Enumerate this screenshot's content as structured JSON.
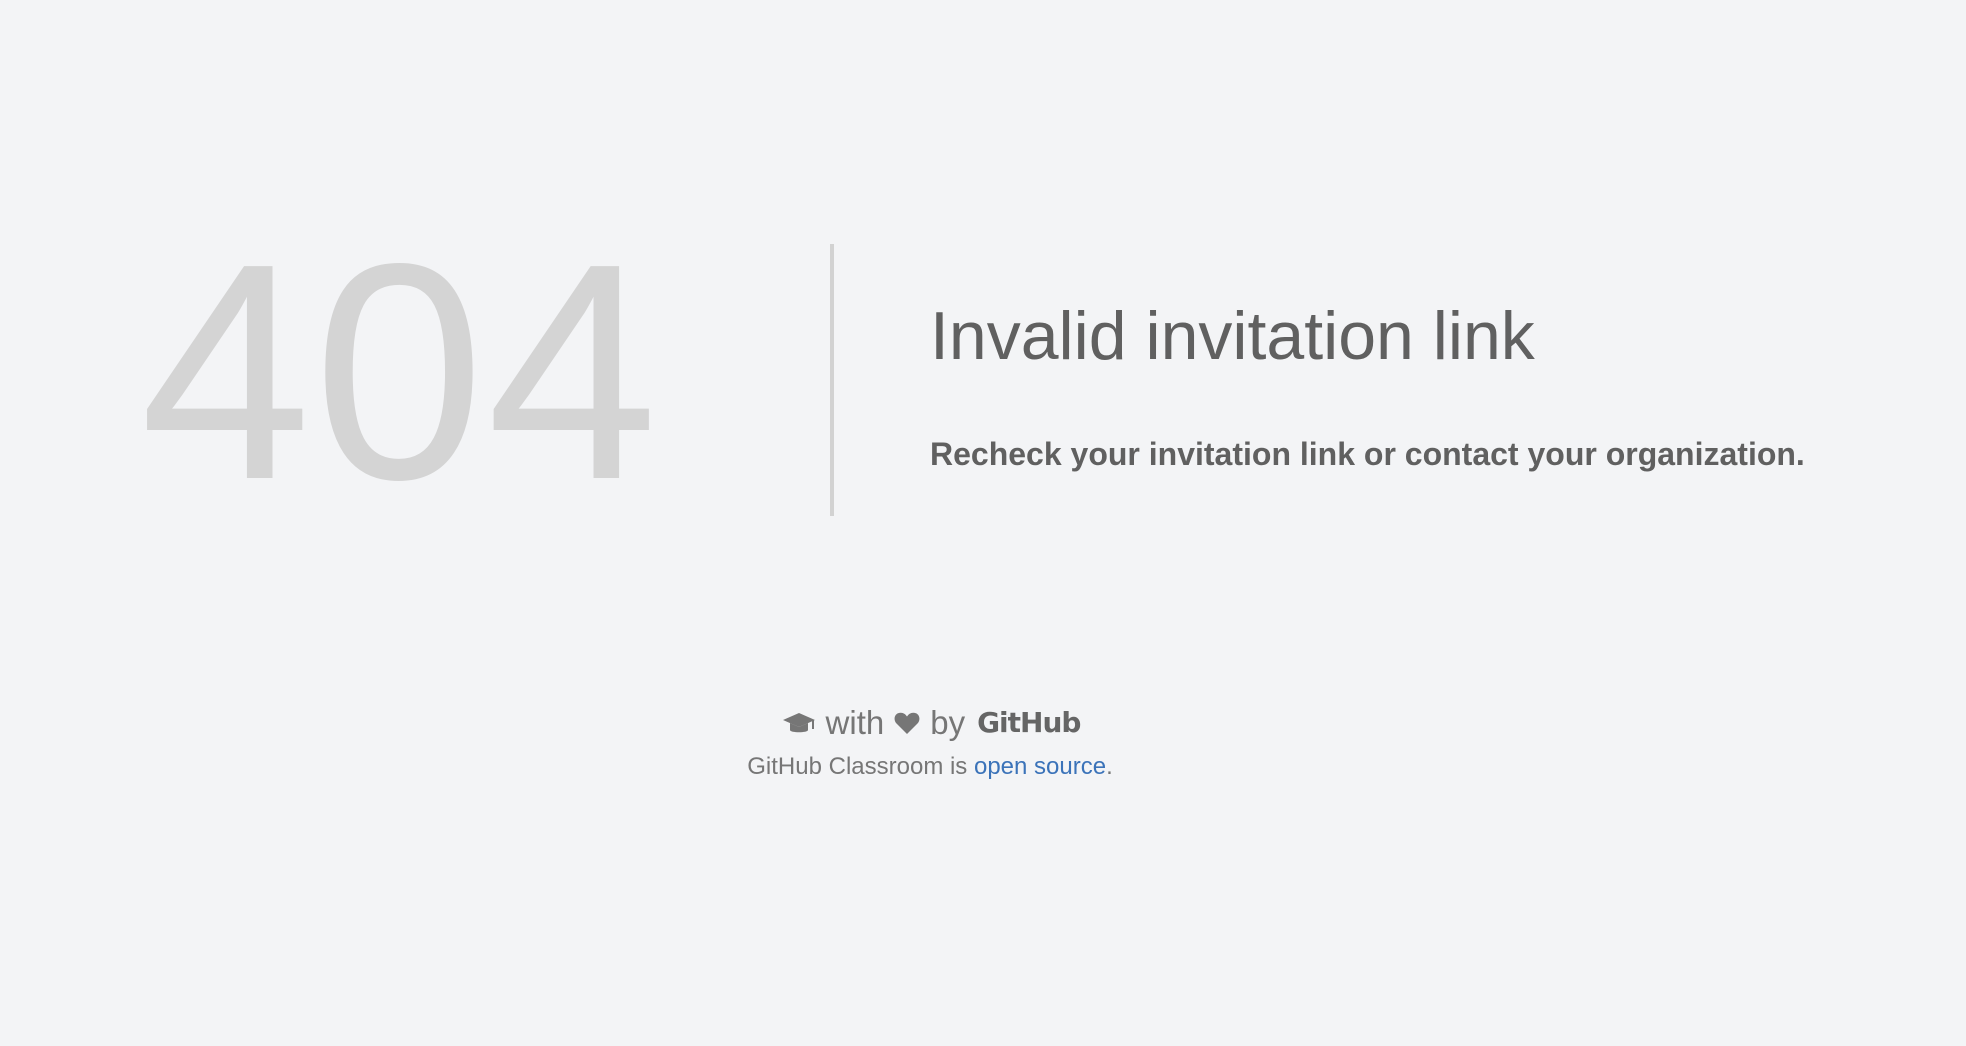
{
  "error": {
    "code": "404",
    "title": "Invalid invitation link",
    "message": "Recheck your invitation link or contact your organization."
  },
  "footer": {
    "icons": {
      "cap": "graduation-cap-icon",
      "heart": "heart-icon"
    },
    "with_text": "with",
    "by_text": "by",
    "brand": "GitHub",
    "line_prefix": "GitHub Classroom is ",
    "link_text": "open source",
    "line_suffix": "."
  },
  "colors": {
    "background": "#f3f4f6",
    "code": "#d4d4d4",
    "text": "#606060",
    "link": "#3b73b9"
  }
}
